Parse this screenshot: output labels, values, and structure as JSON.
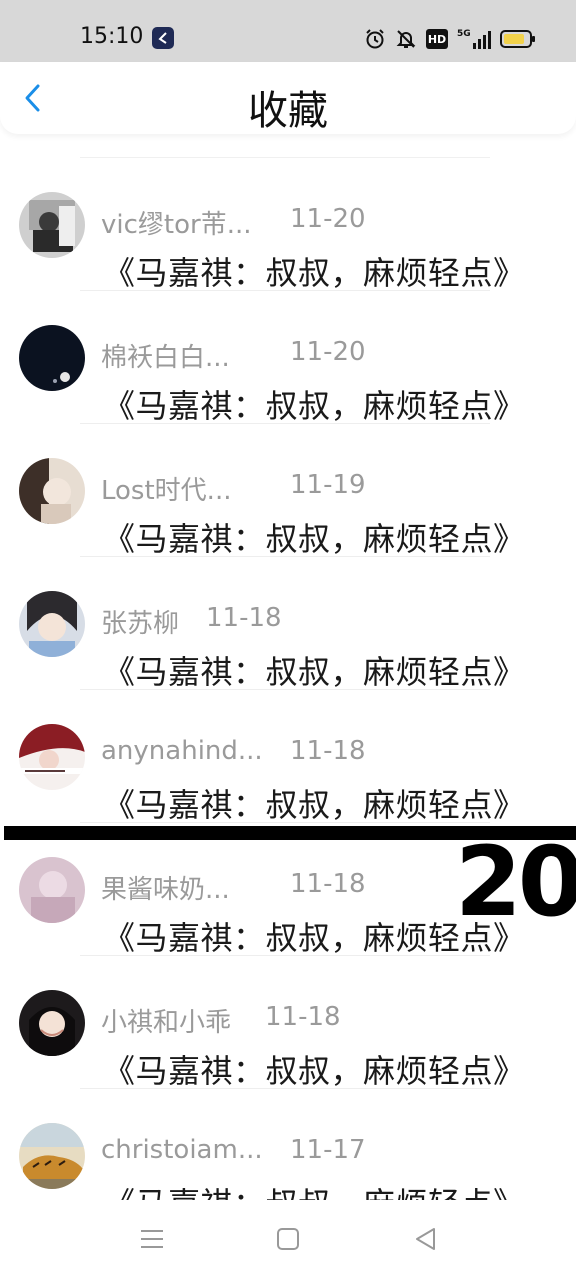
{
  "status_bar": {
    "time": "15:10",
    "icons": [
      "app-icon",
      "alarm-icon",
      "mute-bell-icon",
      "hd-icon",
      "signal-5g-icon",
      "battery-icon"
    ],
    "hd_label": "HD",
    "network_label": "5G",
    "battery_color": "#f2d24b"
  },
  "header": {
    "title": "收藏",
    "back_icon": "chevron-left-icon",
    "accent_color": "#1a8ee8"
  },
  "favorites": [
    {
      "user": "vic缪tor芾...",
      "date": "11-20",
      "title": "《马嘉祺：叔叔，麻烦轻点》"
    },
    {
      "user": "棉袄白白...",
      "date": "11-20",
      "title": "《马嘉祺：叔叔，麻烦轻点》"
    },
    {
      "user": "Lost时代...",
      "date": "11-19",
      "title": "《马嘉祺：叔叔，麻烦轻点》"
    },
    {
      "user": "张苏柳",
      "date": "11-18",
      "title": "《马嘉祺：叔叔，麻烦轻点》"
    },
    {
      "user": "anynahind...",
      "date": "11-18",
      "title": "《马嘉祺：叔叔，麻烦轻点》"
    },
    {
      "user": "果酱味奶...",
      "date": "11-18",
      "title": "《马嘉祺：叔叔，麻烦轻点》"
    },
    {
      "user": "小祺和小乖",
      "date": "11-18",
      "title": "《马嘉祺：叔叔，麻烦轻点》"
    },
    {
      "user": "christoiam...",
      "date": "11-17",
      "title": "《马嘉祺：叔叔，麻烦轻点》"
    }
  ],
  "overlay": {
    "number": "20"
  },
  "nav_bar": {
    "buttons": [
      "menu-icon",
      "home-square-icon",
      "back-triangle-icon"
    ]
  }
}
